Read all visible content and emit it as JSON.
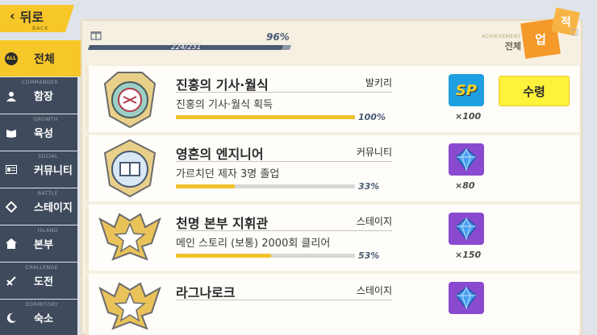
{
  "back": {
    "label": "뒤로",
    "sub": "BACK",
    "icon": "chevron-left-icon"
  },
  "sidebar": {
    "items": [
      {
        "en": "",
        "ko": "전체",
        "icon": "ALL",
        "active": true
      },
      {
        "en": "COMMANDER",
        "ko": "함장",
        "icon": "commander-icon"
      },
      {
        "en": "GROWTH",
        "ko": "육성",
        "icon": "book-icon"
      },
      {
        "en": "SOCIAL",
        "ko": "커뮤니티",
        "icon": "id-card-icon"
      },
      {
        "en": "BATTLE",
        "ko": "스테이지",
        "icon": "diamond-icon"
      },
      {
        "en": "ISLAND",
        "ko": "본부",
        "icon": "house-icon"
      },
      {
        "en": "CHALLENGE",
        "ko": "도전",
        "icon": "sword-icon"
      },
      {
        "en": "DORMITORY",
        "ko": "숙소",
        "icon": "moon-icon"
      }
    ]
  },
  "header": {
    "count": "224/231",
    "percent": "96%",
    "progress": 0.96,
    "achievement_en": "ACHIEVEMENT",
    "achievement_ko": "전체",
    "tag1": "업",
    "tag2": "적"
  },
  "achievements": [
    {
      "title": "진홍의 기사·월식",
      "category": "발키리",
      "desc": "진홍의 기사·월식 획득",
      "progress": 1.0,
      "pct": "100%",
      "reward": "SP",
      "reward_type": "sp",
      "qty": "×100",
      "claim": "수령"
    },
    {
      "title": "영혼의 엔지니어",
      "category": "커뮤니티",
      "desc": "가르치던 제자 3명 졸업",
      "progress": 0.33,
      "pct": "33%",
      "reward": "crystal-icon",
      "reward_type": "gem",
      "qty": "×80"
    },
    {
      "title": "천명 본부 지휘관",
      "category": "스테이지",
      "desc": "메인 스토리 (보통) 2000회 클리어",
      "progress": 0.53,
      "pct": "53%",
      "reward": "crystal-icon",
      "reward_type": "gem",
      "qty": "×150"
    },
    {
      "title": "라그나로크",
      "category": "스테이지",
      "desc": "",
      "progress": 0,
      "pct": "",
      "reward": "crystal-icon",
      "reward_type": "gem",
      "qty": ""
    }
  ],
  "colors": {
    "accent": "#f7c72a",
    "sidebar": "#3f4a5c",
    "panel": "#f6f0e2",
    "bar_fill": "#f1c22d",
    "claim": "#fff23a"
  }
}
